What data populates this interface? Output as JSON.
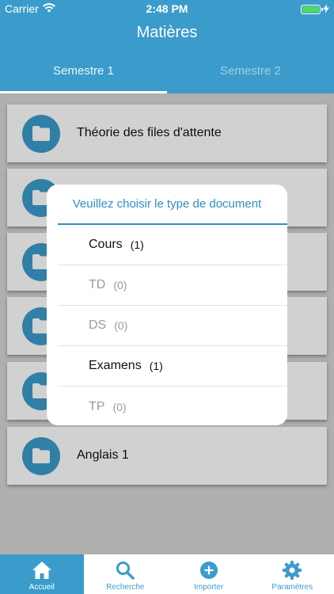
{
  "status": {
    "carrier": "Carrier",
    "time": "2:48 PM"
  },
  "header": {
    "title": "Matières"
  },
  "tabs": [
    {
      "label": "Semestre 1",
      "active": true
    },
    {
      "label": "Semestre 2",
      "active": false
    }
  ],
  "subjects": [
    {
      "name": "Théorie des files d'attente"
    },
    {
      "name": ""
    },
    {
      "name": ""
    },
    {
      "name": ""
    },
    {
      "name": ""
    },
    {
      "name": "Anglais 1"
    }
  ],
  "dialog": {
    "title": "Veuillez choisir le type de document",
    "options": [
      {
        "label": "Cours",
        "count": "(1)",
        "enabled": true
      },
      {
        "label": "TD",
        "count": "(0)",
        "enabled": false
      },
      {
        "label": "DS",
        "count": "(0)",
        "enabled": false
      },
      {
        "label": "Examens",
        "count": "(1)",
        "enabled": true
      },
      {
        "label": "TP",
        "count": "(0)",
        "enabled": false
      }
    ]
  },
  "bottom_nav": [
    {
      "label": "Accueil",
      "icon": "home-icon",
      "active": true
    },
    {
      "label": "Recherche",
      "icon": "search-icon",
      "active": false
    },
    {
      "label": "Importer",
      "icon": "plus-circle-icon",
      "active": false
    },
    {
      "label": "Paramètres",
      "icon": "gear-icon",
      "active": false
    }
  ],
  "colors": {
    "accent": "#3b9ccb",
    "battery": "#4cd964"
  }
}
